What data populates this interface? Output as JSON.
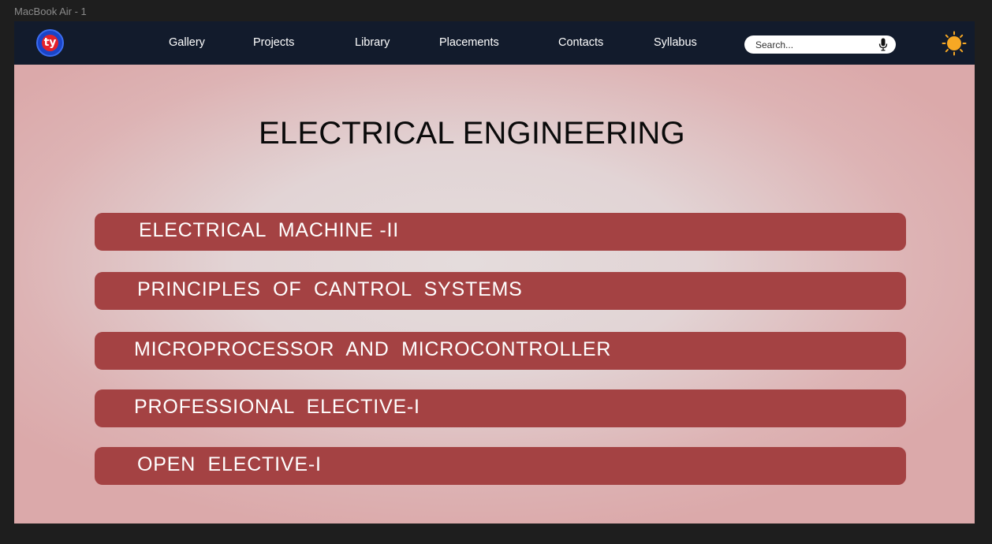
{
  "frame_label": "MacBook Air - 1",
  "nav": {
    "logo_glyph": "ty",
    "links": [
      "Gallery",
      "Projects",
      "Library",
      "Placements",
      "Contacts",
      "Syllabus"
    ],
    "search_placeholder": "Search...",
    "mic_icon": "microphone-icon",
    "theme_icon": "sun-icon"
  },
  "main": {
    "title": "ELECTRICAL ENGINEERING",
    "subjects": [
      "ELECTRICAL  MACHINE -II",
      "PRINCIPLES  OF  CANTROL  SYSTEMS",
      "MICROPROCESSOR  AND  MICROCONTROLLER",
      "PROFESSIONAL  ELECTIVE-I",
      "OPEN  ELECTIVE-I"
    ]
  },
  "colors": {
    "navbar": "#121b2c",
    "subject_bar": "#a44243",
    "sun": "#f7a824",
    "logo_blue": "#1a44c8",
    "logo_red": "#e3222a"
  }
}
